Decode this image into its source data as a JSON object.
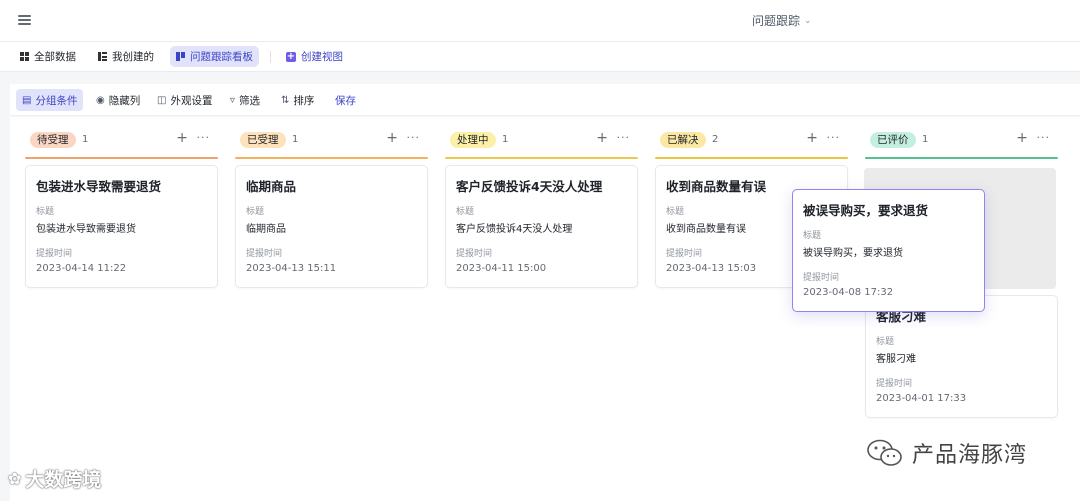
{
  "topbar": {
    "menu_icon": "hamburger-icon",
    "view_title": "问题跟踪",
    "view_title_icon": "chevron-down-icon"
  },
  "views": {
    "tabs": [
      {
        "label": "全部数据",
        "icon": "grid-icon",
        "active": false
      },
      {
        "label": "我创建的",
        "icon": "table-icon",
        "active": false
      },
      {
        "label": "问题跟踪看板",
        "icon": "kanban-icon",
        "active": true
      }
    ],
    "create_view_label": "创建视图",
    "create_view_icon": "plus-box-icon",
    "accent_color": "#3d44c4"
  },
  "toolbar": {
    "group_label": "分组条件",
    "hide_columns_label": "隐藏列",
    "appearance_label": "外观设置",
    "filter_label": "筛选",
    "sort_label": "排序",
    "save_label": "保存"
  },
  "board": {
    "columns": [
      {
        "status": "待受理",
        "count": "1",
        "badge_color": "#fbd6c3",
        "rule_color": "#f0a06a",
        "cards": [
          {
            "title": "包装进水导致需要退货",
            "field1_label": "标题",
            "field1_value": "包装进水导致需要退货",
            "field2_label": "提报时间",
            "field2_value": "2023-04-14 11:22"
          }
        ]
      },
      {
        "status": "已受理",
        "count": "1",
        "badge_color": "#fde2bb",
        "rule_color": "#f2b15a",
        "cards": [
          {
            "title": "临期商品",
            "field1_label": "标题",
            "field1_value": "临期商品",
            "field2_label": "提报时间",
            "field2_value": "2023-04-13 15:11"
          }
        ]
      },
      {
        "status": "处理中",
        "count": "1",
        "badge_color": "#fcefa6",
        "rule_color": "#ecc94b",
        "cards": [
          {
            "title": "客户反馈投诉4天没人处理",
            "field1_label": "标题",
            "field1_value": "客户反馈投诉4天没人处理",
            "field2_label": "提报时间",
            "field2_value": "2023-04-11 15:00"
          }
        ]
      },
      {
        "status": "已解决",
        "count": "2",
        "badge_color": "#fbe9a3",
        "rule_color": "#e9c63e",
        "cards": [
          {
            "title": "收到商品数量有误",
            "field1_label": "标题",
            "field1_value": "收到商品数量有误",
            "field2_label": "提报时间",
            "field2_value": "2023-04-13 15:03"
          }
        ]
      },
      {
        "status": "已评价",
        "count": "1",
        "badge_color": "#c4efde",
        "rule_color": "#55c08f",
        "cards": [
          {
            "title": "客服刁难",
            "field1_label": "标题",
            "field1_value": "客服刁难",
            "field2_label": "提报时间",
            "field2_value": "2023-04-01 17:33"
          }
        ]
      }
    ],
    "dragging_card": {
      "title": "被误导购买，要求退货",
      "field1_label": "标题",
      "field1_value": "被误导购买，要求退货",
      "field2_label": "提报时间",
      "field2_value": "2023-04-08 17:32"
    },
    "add_icon": "plus-icon",
    "more_icon": "more-icon"
  },
  "watermarks": {
    "left_text": "大数跨境",
    "left_logo": "dashuju-logo-icon",
    "right_text": "产品海豚湾",
    "right_logo": "wechat-icon"
  }
}
